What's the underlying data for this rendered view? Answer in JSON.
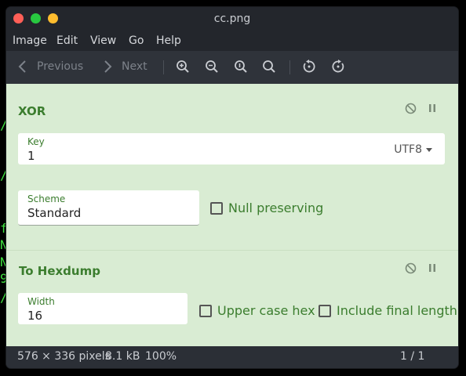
{
  "window": {
    "title": "cc.png"
  },
  "menu": [
    "Image",
    "Edit",
    "View",
    "Go",
    "Help"
  ],
  "toolbar": {
    "previous": "Previous",
    "next": "Next"
  },
  "background_terminal": [
    "/",
    "/",
    "f",
    "N",
    "N",
    "9",
    "/"
  ],
  "operations": {
    "xor": {
      "title": "XOR",
      "key_label": "Key",
      "key_value": "1",
      "encoding": "UTF8",
      "scheme_label": "Scheme",
      "scheme_value": "Standard",
      "null_preserving": "Null preserving"
    },
    "hexdump": {
      "title": "To Hexdump",
      "width_label": "Width",
      "width_value": "16",
      "upper_case_hex": "Upper case hex",
      "include_final_length": "Include final length"
    }
  },
  "status": {
    "dimensions": "576 × 336 pixels",
    "size": "8.1 kB",
    "zoom": "100%",
    "page": "1 / 1"
  },
  "colors": {
    "accent_green": "#3b7d2e",
    "panel_bg": "#d9ecd3",
    "chrome": "#2b2f36"
  }
}
